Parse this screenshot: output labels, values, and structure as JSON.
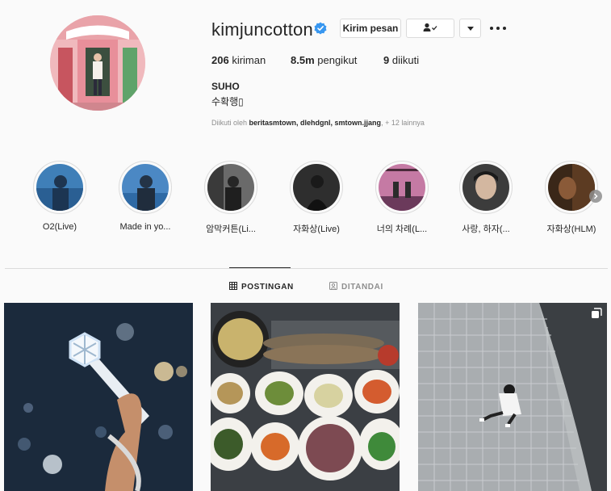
{
  "profile": {
    "username": "kimjuncotton",
    "verified": true,
    "message_button": "Kirim pesan",
    "posts_count": "206",
    "posts_label": "kiriman",
    "followers_count": "8.5m",
    "followers_label": "pengikut",
    "following_count": "9",
    "following_label": "diikuti",
    "full_name": "SUHO",
    "bio": "수확행▯",
    "followed_by_prefix": "Diikuti oleh",
    "followed_by_names": "beritasmtown, dlehdgnl, smtown.jjang",
    "followed_by_more": ", + 12 lainnya"
  },
  "highlights": [
    {
      "label": "O2(Live)"
    },
    {
      "label": "Made in yo..."
    },
    {
      "label": "암막커튼(Li..."
    },
    {
      "label": "자화상(Live)"
    },
    {
      "label": "너의 차례(L..."
    },
    {
      "label": "사랑, 하자(..."
    },
    {
      "label": "자화상(HLM)"
    }
  ],
  "tabs": {
    "posts": "POSTINGAN",
    "tagged": "DITANDAI"
  },
  "icons": {
    "verified": "verified-badge-icon",
    "follow_status": "person-check-icon",
    "dropdown": "chevron-down-icon",
    "more": "more-options-icon",
    "posts_tab": "grid-icon",
    "tagged_tab": "tagged-icon",
    "carousel": "multiple-posts-icon",
    "next": "chevron-right-icon"
  },
  "colors": {
    "verified": "#3897f0",
    "text": "#262626",
    "muted": "#8e8e8e",
    "border": "#dbdbdb",
    "background": "#fafafa"
  }
}
